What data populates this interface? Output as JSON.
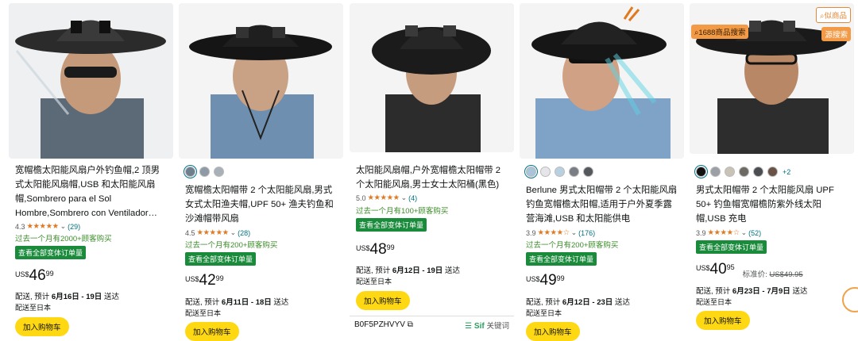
{
  "products": [
    {
      "title": "宽帽檐太阳能风扇户外钓鱼帽,2 顶男式太阳能风扇帽,USB 和太阳能风扇帽,Sombrero para el Sol Hombre,Sombrero con Ventilador…",
      "rating": "4.3",
      "stars": "★★★★★",
      "reviews": "(29)",
      "bought": "过去一个月有2000+顾客购买",
      "badge": "查看全部变体订单量",
      "currency": "US$",
      "whole": "46",
      "fraction": "99",
      "list_label": "",
      "list_price": "",
      "delivery_prefix": "配送, 预计",
      "delivery_dates": "6月16日 - 19日",
      "delivery_suffix": "送达",
      "ship_to": "配送至日本",
      "cart": "加入购物车",
      "swatches": []
    },
    {
      "title": "宽帽檐太阳帽带 2 个太阳能风扇,男式女式太阳渔夫帽,UPF 50+ 渔夫钓鱼和沙滩帽带风扇",
      "rating": "4.5",
      "stars": "★★★★★",
      "reviews": "(28)",
      "bought": "过去一个月有200+顾客购买",
      "badge": "查看全部变体订单量",
      "currency": "US$",
      "whole": "42",
      "fraction": "99",
      "list_label": "",
      "list_price": "",
      "delivery_prefix": "配送, 预计",
      "delivery_dates": "6月11日 - 18日",
      "delivery_suffix": "送达",
      "ship_to": "配送至日本",
      "cart": "加入购物车",
      "swatches": [
        "#6f7f8e",
        "#8e9aa6",
        "#a8b0b8"
      ]
    },
    {
      "title": "太阳能风扇帽,户外宽帽檐太阳帽带 2 个太阳能风扇,男士女士太阳桶(黑色)",
      "rating": "5.0",
      "stars": "★★★★★",
      "reviews": "(4)",
      "bought": "过去一个月有100+顾客购买",
      "badge": "查看全部变体订单量",
      "currency": "US$",
      "whole": "48",
      "fraction": "99",
      "list_label": "",
      "list_price": "",
      "delivery_prefix": "配送, 预计",
      "delivery_dates": "6月12日 - 19日",
      "delivery_suffix": "送达",
      "ship_to": "配送至日本",
      "cart": "加入购物车",
      "swatches": []
    },
    {
      "title": "Berlune 男式太阳帽带 2 个太阳能风扇钓鱼宽帽檐太阳帽,适用于户外夏季露营海滩,USB 和太阳能供电",
      "rating": "3.9",
      "stars": "★★★★☆",
      "reviews": "(176)",
      "bought": "过去一个月有200+顾客购买",
      "badge": "查看全部变体订单量",
      "currency": "US$",
      "whole": "49",
      "fraction": "99",
      "list_label": "",
      "list_price": "",
      "delivery_prefix": "配送, 预计",
      "delivery_dates": "6月12日 - 23日",
      "delivery_suffix": "送达",
      "ship_to": "配送至日本",
      "cart": "加入购物车",
      "swatches": [
        "#a9c4d8",
        "#e6e6ea",
        "#b9d0e0",
        "#7a7e84",
        "#55585c"
      ]
    },
    {
      "title": "男式太阳帽带 2 个太阳能风扇 UPF 50+ 钓鱼帽宽帽檐防紫外线太阳帽,USB 充电",
      "rating": "3.9",
      "stars": "★★★★☆",
      "reviews": "(52)",
      "bought": "",
      "badge": "查看全部变体订单量",
      "currency": "US$",
      "whole": "40",
      "fraction": "95",
      "list_label": "标准价:",
      "list_price": "US$49.95",
      "delivery_prefix": "配送, 预计",
      "delivery_dates": "6月23日 - 7月9日",
      "delivery_suffix": "送达",
      "ship_to": "配送至日本",
      "cart": "加入购物车",
      "swatches": [
        "#111111",
        "#9aa0a6",
        "#c9c2b6",
        "#6d6a66",
        "#4b4d50",
        "#6a5246"
      ],
      "more_swatches": "+2"
    }
  ],
  "overlay": {
    "similar": "似",
    "similar_label": "似商品",
    "search_1688": "1688商品搜索",
    "source_search": "源搜索"
  },
  "asin_bar": {
    "asin": "B0F5PZHVYV",
    "sif": "Sif",
    "keywords": "关键词"
  }
}
